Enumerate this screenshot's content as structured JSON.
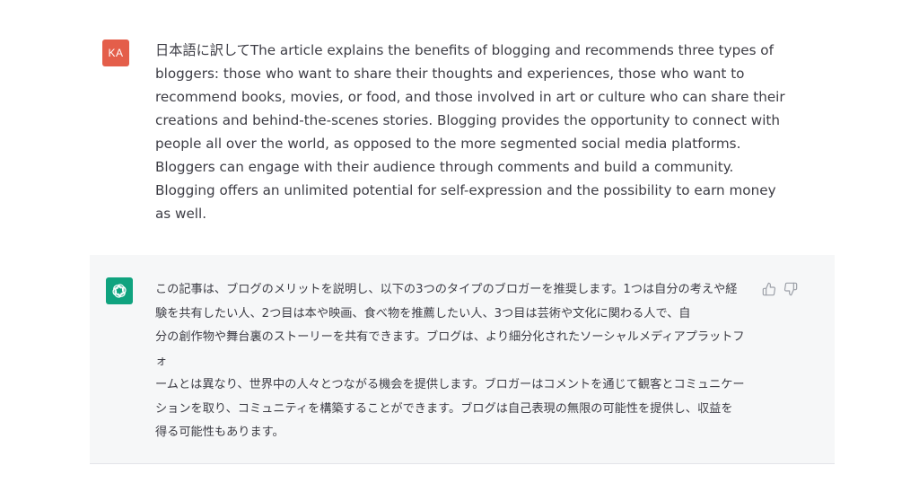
{
  "user_message": {
    "avatar_initials": "KA",
    "avatar_color": "#e45e4a",
    "lines": [
      "日本語に訳してThe article explains the benefits of blogging and recommends three types of",
      "bloggers: those who want to share their thoughts and experiences, those who want to",
      "recommend books, movies, or food, and those involved in art or culture who can share their",
      "creations and behind-the-scenes stories. Blogging provides the opportunity to connect with",
      "people all over the world, as opposed to the more segmented social media platforms.",
      "Bloggers can engage with their audience through comments and build a community.",
      "Blogging offers an unlimited potential for self-expression and the possibility to earn money",
      "as well."
    ]
  },
  "assistant_message": {
    "avatar_icon": "openai-logo-icon",
    "avatar_color": "#10a37f",
    "background": "#f6f7f8",
    "lines": [
      "この記事は、ブログのメリットを説明し、以下の3つのタイプのブロガーを推奨します。1つは自分の考えや経",
      "験を共有したい人、2つ目は本や映画、食べ物を推薦したい人、3つ目は芸術や文化に関わる人で、自",
      "分の創作物や舞台裏のストーリーを共有できます。ブログは、より細分化されたソーシャルメディアプラットフォ",
      "ームとは異なり、世界中の人々とつながる機会を提供します。ブロガーはコメントを通じて観客とコミュニケー",
      "ションを取り、コミュニティを構築することができます。ブログは自己表現の無限の可能性を提供し、収益を",
      "得る可能性もあります。"
    ],
    "feedback": {
      "thumbs_up_icon": "thumbs-up-icon",
      "thumbs_down_icon": "thumbs-down-icon"
    }
  }
}
